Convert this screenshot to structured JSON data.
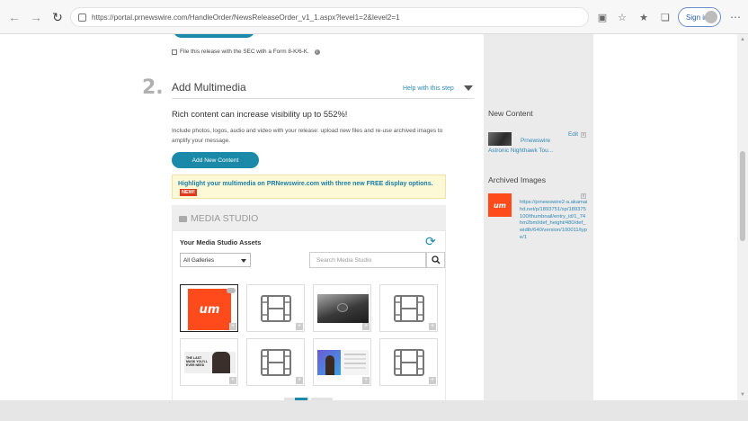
{
  "browser": {
    "url": "https://portal.prnewswire.com/HandleOrder/NewsReleaseOrder_v1_1.aspx?level1=2&level2=1",
    "signin_label": "Sign in"
  },
  "sec_filing": {
    "label": "File this release with the SEC with a Form 8-K/6-K."
  },
  "step": {
    "number": "2.",
    "title": "Add Multimedia",
    "help_label": "Help with this step"
  },
  "content": {
    "headline": "Rich content can increase visibility up to 552%!",
    "description": "Include photos, logos, audio and video with your release: upload new files and re-use archived images to amplify your message.",
    "add_button_label": "Add New Content",
    "promo_text": "Highlight your multimedia on PRNewswire.com with three new FREE display options.",
    "promo_badge": "NEW!"
  },
  "media_studio": {
    "title": "MEDIA STUDIO",
    "assets_label": "Your Media Studio Assets",
    "gallery_selected": "All Galleries",
    "search_placeholder": "Search Media Studio",
    "logo_text": "um",
    "mask_caption": "THE LAST MASK YOU'LL EVER NEED"
  },
  "right_column": {
    "new_content_title": "New Content",
    "new_content_source": "Prnewswire",
    "new_content_item": "Astronic Nighthawk Tou...",
    "edit_label": "Edit",
    "close_label": "x",
    "archived_title": "Archived Images",
    "archived_logo_text": "um",
    "archived_url": "https://prnewswire2-a.akamaihd.net/p/1893751/sp/189375100/thumbnail/entry_id/1_74hm2bml/def_height/480/def_width/640/version/100011/type/1"
  },
  "colors": {
    "accent": "#1a8aa8",
    "brand_orange": "#ff4a1c",
    "promo_bg": "#fdf8d5",
    "badge_red": "#e03a1e"
  }
}
